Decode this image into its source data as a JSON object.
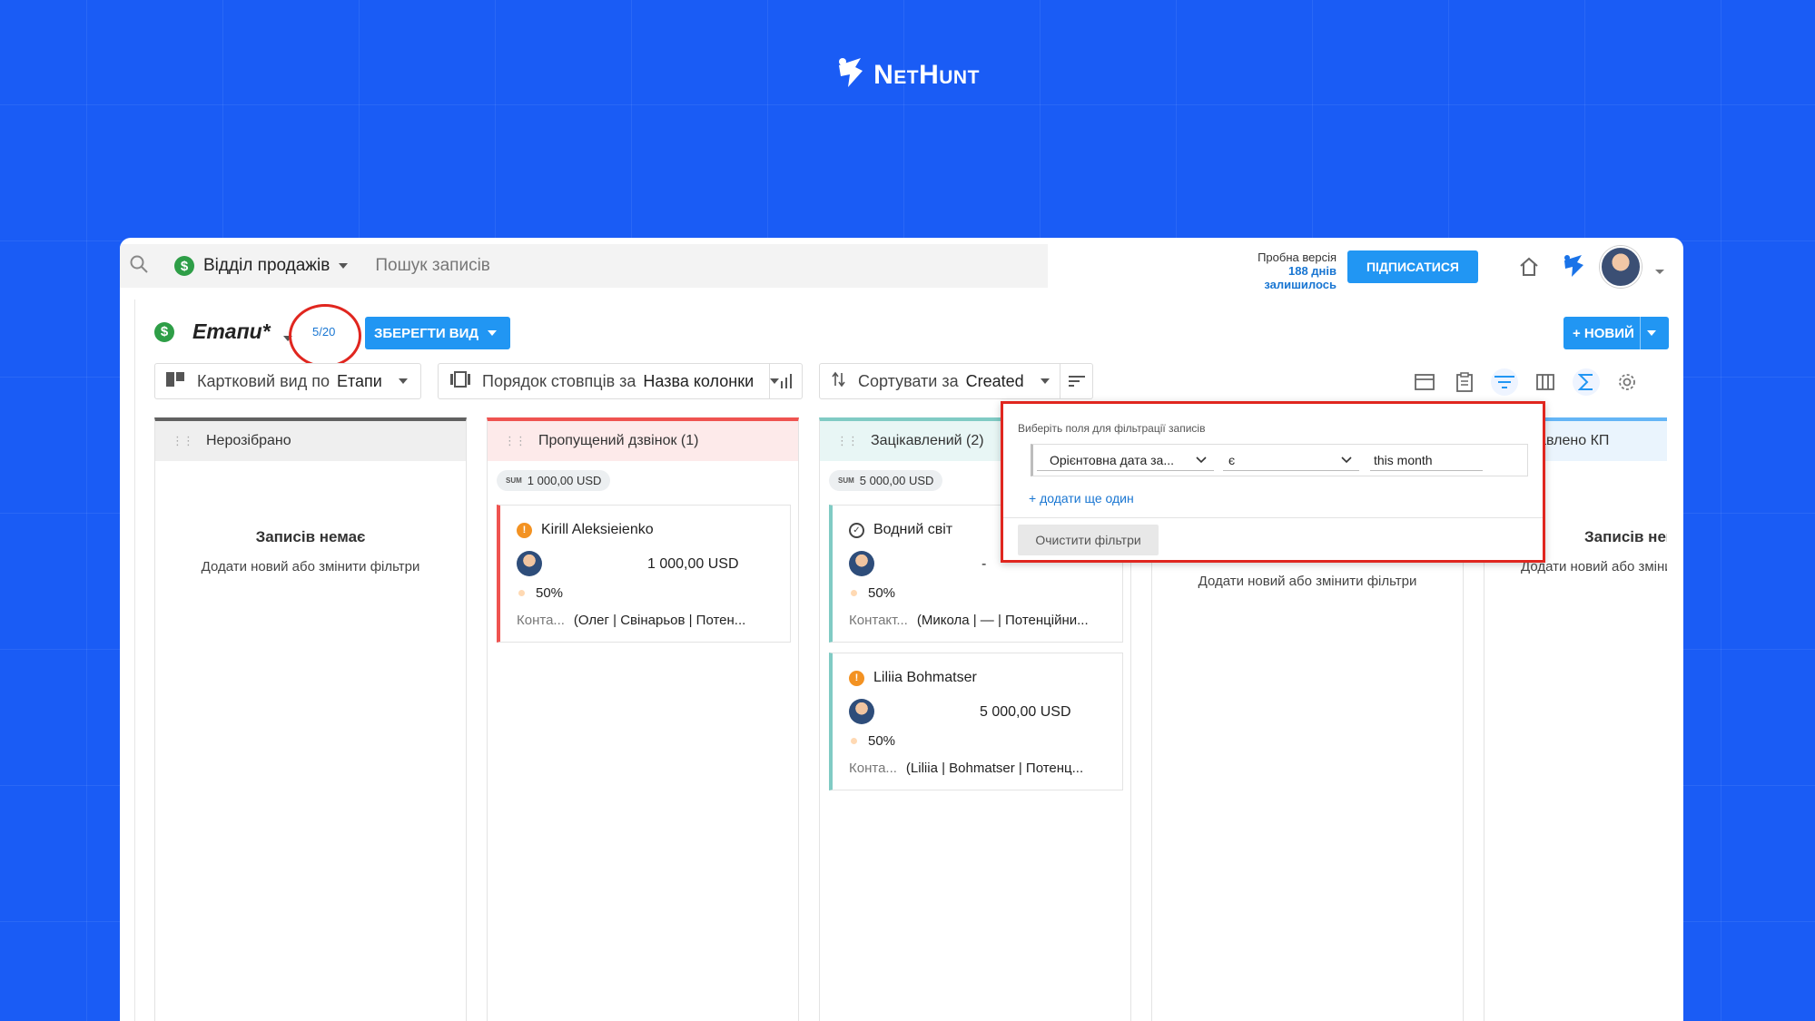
{
  "brand": {
    "name": "NetHunt"
  },
  "topbar": {
    "department": "Відділ продажів",
    "search_placeholder": "Пошук записів",
    "trial_label": "Пробна версія",
    "trial_days": "188 днів залишилось",
    "subscribe_label": "ПІДПИСАТИСЯ"
  },
  "viewbar": {
    "title": "Етапи*",
    "counter": "5/20",
    "save_label": "ЗБЕРЕГТИ ВИД",
    "new_label": "+ НОВИЙ"
  },
  "toolbar": {
    "card_view_prefix": "Картковий вид по",
    "card_view_value": "Етапи",
    "column_order_prefix": "Порядок стовпців за",
    "column_order_value": "Назва колонки",
    "sort_prefix": "Сортувати за",
    "sort_value": "Created"
  },
  "columns": [
    {
      "title": "Нерозібрано",
      "accent": "#616161",
      "empty_title": "Записів немає",
      "empty_sub": "Додати новий або змінити фільтри"
    },
    {
      "title": "Пропущений дзвінок  (1)",
      "accent": "#ef5350",
      "sum_label": "SUM",
      "sum": "1 000,00 USD"
    },
    {
      "title": "Зацікавлений  (2)",
      "accent": "#80cbc4",
      "sum_label": "SUM",
      "sum": "5 000,00 USD"
    },
    {
      "title": "",
      "accent": "#e3e3e3",
      "empty_sub": "Додати новий або змінити фільтри"
    },
    {
      "title": "Відправлено КП",
      "accent": "#64b5f6",
      "empty_title": "Записів немає",
      "empty_sub": "Додати новий або змінити фільтри"
    }
  ],
  "cards": [
    {
      "name": "Kirill Aleksieienko",
      "amount": "1 000,00 USD",
      "probability": "50%",
      "contact_label": "Конта...",
      "contact": "(Олег | Свінарьов | Потен...",
      "accent": "#ef5350"
    },
    {
      "name": "Водний світ",
      "amount": "-",
      "probability": "50%",
      "contact_label": "Контакт...",
      "contact": "(Микола | — | Потенційни...",
      "accent": "#80cbc4"
    },
    {
      "name": "Liliia Bohmatser",
      "amount": "5 000,00 USD",
      "probability": "50%",
      "contact_label": "Конта...",
      "contact": "(Liliia | Bohmatser | Потенц...",
      "accent": "#80cbc4"
    }
  ],
  "filter_popup": {
    "title": "Виберіть поля для фільтрації записів",
    "field": "Орієнтовна дата за...",
    "operator": "є",
    "value": "this month",
    "add_label": "+ додати ще один",
    "clear_label": "Очистити фільтри"
  },
  "colors": {
    "brand_bg": "#1a5cf5",
    "primary": "#2196f3",
    "highlight": "#e0261f"
  }
}
